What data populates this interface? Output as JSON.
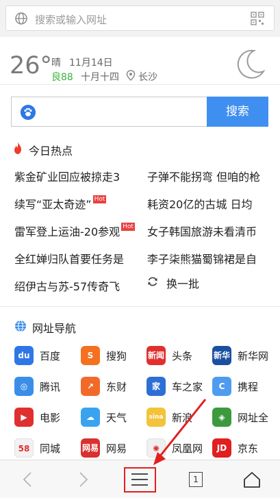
{
  "address_bar": {
    "placeholder": "搜索或输入网址",
    "globe_icon": "globe-icon",
    "qr_icon": "qrcode-scan-icon"
  },
  "weather": {
    "temperature": "26°",
    "condition": "晴",
    "date": "11月14日",
    "air_quality": "良88",
    "lunar_date": "十月十四",
    "city": "长沙",
    "icon": "moon-icon",
    "aqi_color": "#3bb23b"
  },
  "search": {
    "button_label": "搜索",
    "engine_icon": "baidu-paw-icon",
    "button_color": "#3f8ff0"
  },
  "hot_news": {
    "title": "今日热点",
    "items": [
      {
        "text": "紫金矿业回应被掠走3",
        "hot": ""
      },
      {
        "text": "子弹不能拐弯 但咱的枪",
        "hot": ""
      },
      {
        "text": "续写“亚太奇迹”",
        "hot": "Hot"
      },
      {
        "text": "耗资20亿的古城 日均",
        "hot": ""
      },
      {
        "text": "雷军登上运油-20参观",
        "hot": "Hot"
      },
      {
        "text": "女子韩国旅游未看清币",
        "hot": ""
      },
      {
        "text": "全红婵归队首要任务是",
        "hot": ""
      },
      {
        "text": "李子柒熊猫蜀锦裙是自",
        "hot": ""
      },
      {
        "text": "绍伊古与苏-57传奇飞",
        "hot": ""
      }
    ],
    "refresh_label": "换一批"
  },
  "site_nav": {
    "title": "网址导航",
    "sites": [
      {
        "label": "百度",
        "icon": "baidu-icon",
        "color": "#2f76e6",
        "glyph": "du"
      },
      {
        "label": "搜狗",
        "icon": "sogou-icon",
        "color": "#f5701f",
        "glyph": "S"
      },
      {
        "label": "头条",
        "icon": "toutiao-icon",
        "color": "#e02f2f",
        "glyph": "新闻"
      },
      {
        "label": "新华网",
        "icon": "xinhua-icon",
        "color": "#1b4fa0",
        "glyph": "新华"
      },
      {
        "label": "腾讯",
        "icon": "tencent-icon",
        "color": "#3b8ee8",
        "glyph": "◎"
      },
      {
        "label": "东财",
        "icon": "dongcai-icon",
        "color": "#f26a2a",
        "glyph": "↗"
      },
      {
        "label": "车之家",
        "icon": "autohome-icon",
        "color": "#2e6fd6",
        "glyph": "家"
      },
      {
        "label": "携程",
        "icon": "ctrip-icon",
        "color": "#4f9bf0",
        "glyph": "C"
      },
      {
        "label": "电影",
        "icon": "movie-icon",
        "color": "#e02f2f",
        "glyph": "▶"
      },
      {
        "label": "天气",
        "icon": "weather-icon",
        "color": "#3aa3f0",
        "glyph": "☁"
      },
      {
        "label": "新浪",
        "icon": "sina-icon",
        "color": "#f3c33b",
        "glyph": "sina"
      },
      {
        "label": "网址全",
        "icon": "url-all-icon",
        "color": "#3c9a3c",
        "glyph": "◈"
      },
      {
        "label": "同城",
        "icon": "58-icon",
        "color": "#f2f2f2",
        "glyph": "58"
      },
      {
        "label": "网易",
        "icon": "netease-icon",
        "color": "#d93030",
        "glyph": "网易"
      },
      {
        "label": "凤凰网",
        "icon": "ifeng-icon",
        "color": "#f0f0f0",
        "glyph": "✺"
      },
      {
        "label": "京东",
        "icon": "jd-icon",
        "color": "#e02020",
        "glyph": "JD"
      }
    ]
  },
  "bottom_bar": {
    "back_icon": "back-arrow-icon",
    "forward_icon": "forward-arrow-icon",
    "menu_icon": "menu-icon",
    "tab_count": "1",
    "home_icon": "home-icon"
  },
  "annotation": {
    "highlight_color": "#e02020"
  }
}
